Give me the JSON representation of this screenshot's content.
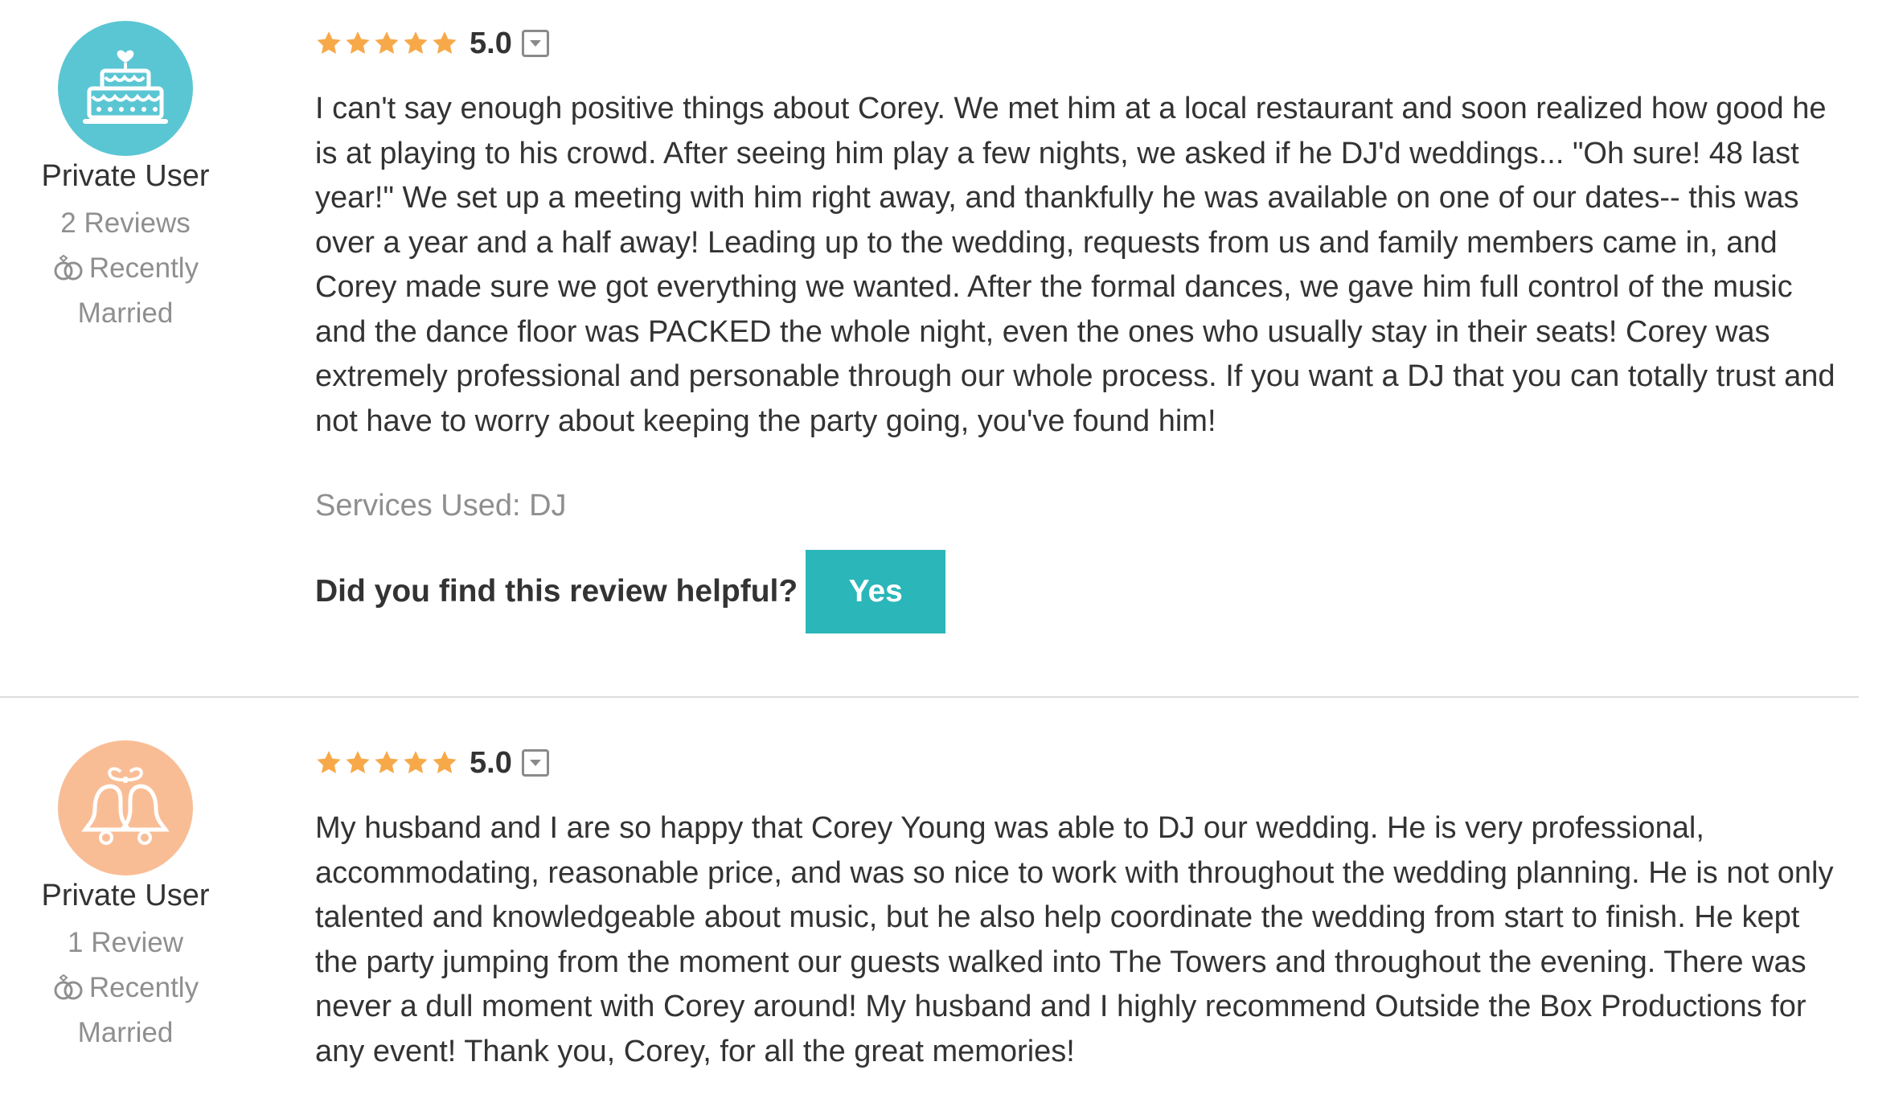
{
  "reviews": [
    {
      "user": {
        "name": "Private User",
        "review_count": "2 Reviews",
        "status_line1": "Recently",
        "status_line2": "Married",
        "avatar_icon": "wedding-cake-icon",
        "avatar_color": "#5bc6d3"
      },
      "rating": {
        "value": "5.0",
        "stars": 5,
        "star_color": "#f7a94a"
      },
      "text": "I can't say enough positive things about Corey. We met him at a local restaurant and soon realized how good he is at playing to his crowd. After seeing him play a few nights, we asked if he DJ'd weddings... \"Oh sure! 48 last year!\" We set up a meeting with him right away, and thankfully he was available on one of our dates-- this was over a year and a half away! Leading up to the wedding, requests from us and family members came in, and Corey made sure we got everything we wanted. After the formal dances, we gave him full control of the music and the dance floor was PACKED the whole night, even the ones who usually stay in their seats! Corey was extremely professional and personable through our whole process. If you want a DJ that you can totally trust and not have to worry about keeping the party going, you've found him!",
      "services_used": "Services Used: DJ",
      "helpful_question": "Did you find this review helpful?",
      "yes_label": "Yes",
      "accent_color": "#2bb6b9"
    },
    {
      "user": {
        "name": "Private User",
        "review_count": "1 Review",
        "status_line1": "Recently",
        "status_line2": "Married",
        "avatar_icon": "wedding-bells-icon",
        "avatar_color": "#f9bd95"
      },
      "rating": {
        "value": "5.0",
        "stars": 5,
        "star_color": "#f7a94a"
      },
      "text": "My husband and I are so happy that Corey Young was able to DJ our wedding. He is very professional, accommodating, reasonable price, and was so nice to work with throughout the wedding planning. He is not only talented and knowledgeable about music, but he also help coordinate the wedding from start to finish. He kept the party jumping from the moment our guests walked into The Towers and throughout the evening. There was never a dull moment with Corey around! My husband and I highly recommend Outside the Box Productions for any event! Thank you, Corey, for all the great memories!"
    }
  ]
}
